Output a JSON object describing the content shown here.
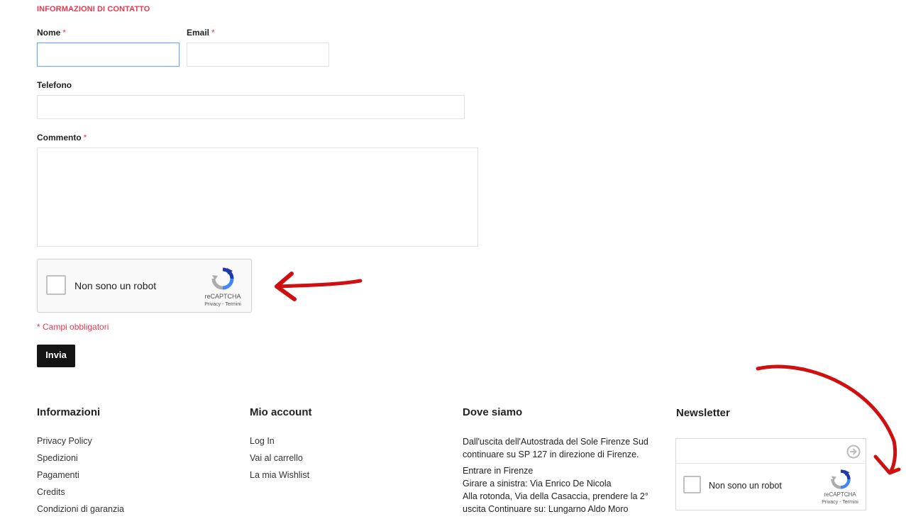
{
  "form": {
    "section_title": "INFORMAZIONI DI CONTATTO",
    "name_label": "Nome",
    "email_label": "Email",
    "phone_label": "Telefono",
    "comment_label": "Commento",
    "required_mark": "*",
    "name_value": "",
    "email_value": "",
    "phone_value": "",
    "comment_value": "",
    "required_note": "* Campi obbligatori",
    "submit_label": "Invia"
  },
  "captcha": {
    "label": "Non sono un robot",
    "brand": "reCAPTCHA",
    "links": "Privacy - Termini"
  },
  "footer": {
    "info": {
      "title": "Informazioni",
      "links": [
        "Privacy Policy",
        "Spedizioni",
        "Pagamenti",
        "Credits",
        "Condizioni di garanzia"
      ]
    },
    "account": {
      "title": "Mio account",
      "links": [
        "Log In",
        "Vai al carrello",
        "La mia Wishlist"
      ]
    },
    "location": {
      "title": "Dove siamo",
      "paragraph1": "Dall'uscita dell'Autostrada del Sole Firenze Sud continuare su SP 127 in direzione di Firenze.",
      "paragraph2": "Entrare in Firenze",
      "paragraph3": "Girare a sinistra: Via Enrico De Nicola",
      "paragraph4": "Alla rotonda, Via della Casaccia, prendere la 2° uscita Continuare su: Lungarno Aldo Moro"
    },
    "newsletter": {
      "title": "Newsletter",
      "input_value": "",
      "captcha_label": "Non sono un robot"
    }
  },
  "colors": {
    "accent": "#e8384f",
    "annotation_arrow": "#d01010",
    "button_bg": "#141414"
  }
}
